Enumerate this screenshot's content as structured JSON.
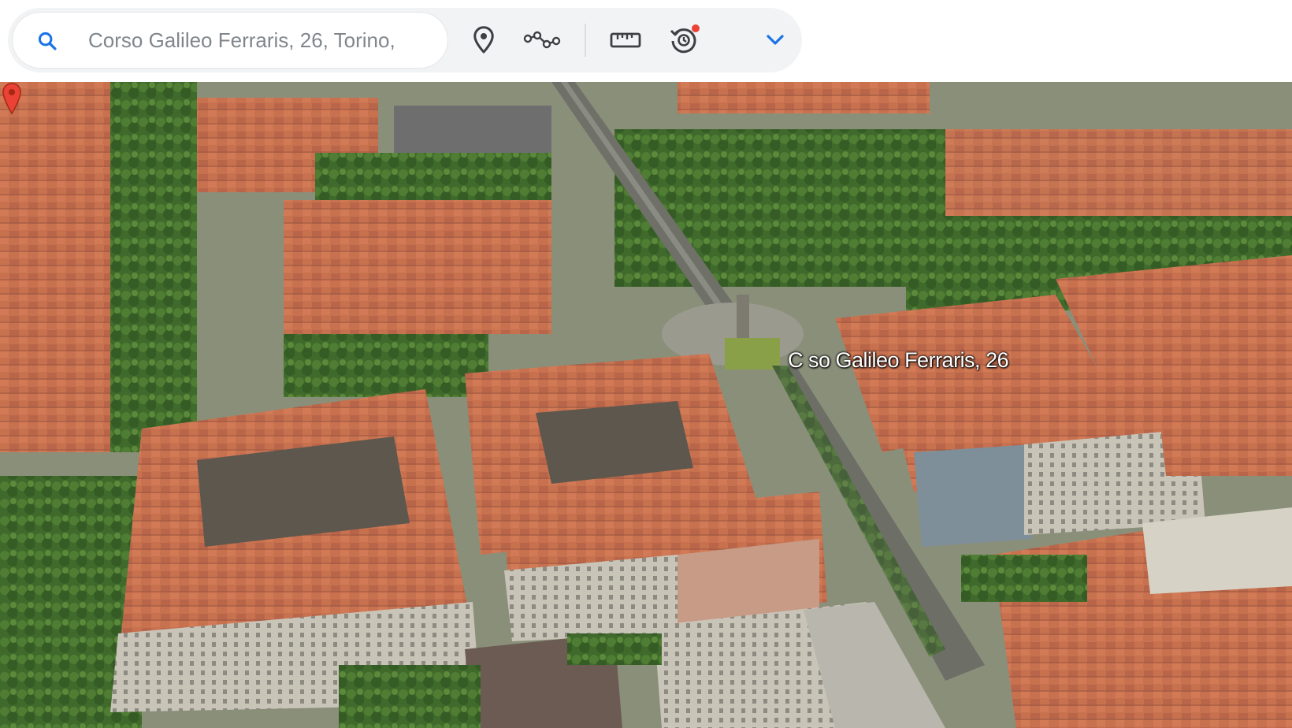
{
  "toolbar": {
    "search": {
      "value": "Corso Galileo Ferraris, 26, Torino,",
      "icon": "search-icon"
    },
    "buttons": [
      {
        "name": "place-pin-button",
        "icon": "location-pin-icon"
      },
      {
        "name": "draw-path-button",
        "icon": "path-polygon-icon"
      },
      {
        "name": "measure-button",
        "icon": "ruler-icon"
      },
      {
        "name": "historical-imagery-button",
        "icon": "history-clock-icon",
        "badge": true
      },
      {
        "name": "more-options-button",
        "icon": "chevron-down-icon"
      }
    ],
    "colors": {
      "accent": "#1a73e8",
      "badge": "#ea4335",
      "icon": "#3c4043"
    }
  },
  "map": {
    "place_label": "C so Galileo Ferraris, 26",
    "pin_color": "#ea4335"
  }
}
